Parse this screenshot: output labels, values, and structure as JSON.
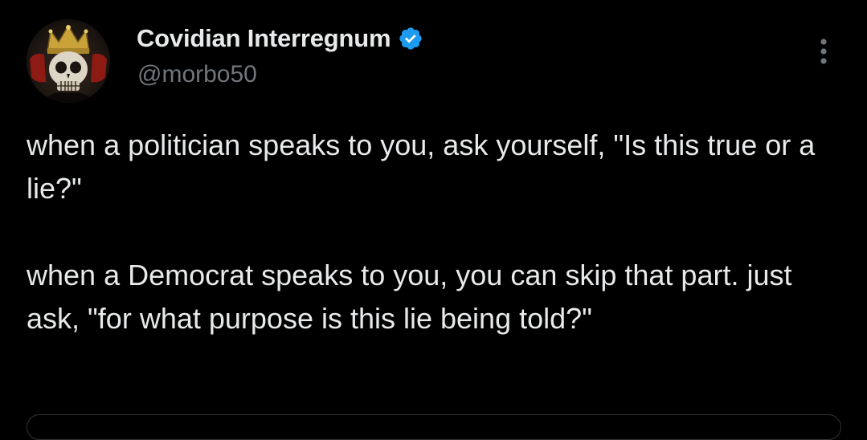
{
  "author": {
    "display_name": "Covidian Interregnum",
    "handle": "@morbo50",
    "verified": true,
    "avatar_icon": "crowned-skull-avatar"
  },
  "menu": {
    "icon": "more-options-icon"
  },
  "tweet": {
    "paragraphs": [
      "when a politician speaks to you, ask yourself, \"Is this true or a lie?\"",
      "when a Democrat speaks to you, you can skip that part. just ask, \"for what purpose is this lie being told?\""
    ]
  },
  "colors": {
    "background": "#000000",
    "text_primary": "#e7e9ea",
    "text_secondary": "#71767b",
    "verified_badge": "#1d9bf0",
    "border": "#2f3336"
  }
}
